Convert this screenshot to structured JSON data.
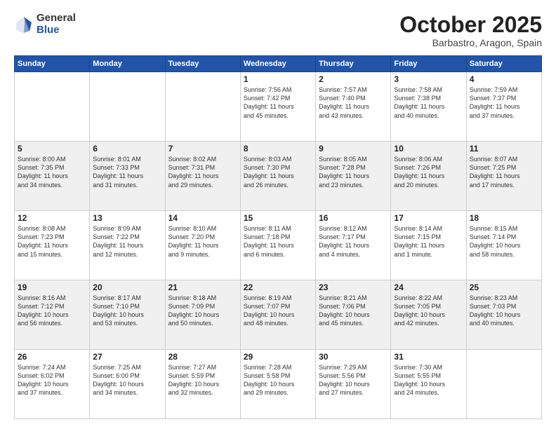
{
  "logo": {
    "general": "General",
    "blue": "Blue"
  },
  "header": {
    "month": "October 2025",
    "location": "Barbastro, Aragon, Spain"
  },
  "weekdays": [
    "Sunday",
    "Monday",
    "Tuesday",
    "Wednesday",
    "Thursday",
    "Friday",
    "Saturday"
  ],
  "weeks": [
    [
      {
        "day": "",
        "info": ""
      },
      {
        "day": "",
        "info": ""
      },
      {
        "day": "",
        "info": ""
      },
      {
        "day": "1",
        "info": "Sunrise: 7:56 AM\nSunset: 7:42 PM\nDaylight: 11 hours\nand 45 minutes."
      },
      {
        "day": "2",
        "info": "Sunrise: 7:57 AM\nSunset: 7:40 PM\nDaylight: 11 hours\nand 43 minutes."
      },
      {
        "day": "3",
        "info": "Sunrise: 7:58 AM\nSunset: 7:38 PM\nDaylight: 11 hours\nand 40 minutes."
      },
      {
        "day": "4",
        "info": "Sunrise: 7:59 AM\nSunset: 7:37 PM\nDaylight: 11 hours\nand 37 minutes."
      }
    ],
    [
      {
        "day": "5",
        "info": "Sunrise: 8:00 AM\nSunset: 7:35 PM\nDaylight: 11 hours\nand 34 minutes."
      },
      {
        "day": "6",
        "info": "Sunrise: 8:01 AM\nSunset: 7:33 PM\nDaylight: 11 hours\nand 31 minutes."
      },
      {
        "day": "7",
        "info": "Sunrise: 8:02 AM\nSunset: 7:31 PM\nDaylight: 11 hours\nand 29 minutes."
      },
      {
        "day": "8",
        "info": "Sunrise: 8:03 AM\nSunset: 7:30 PM\nDaylight: 11 hours\nand 26 minutes."
      },
      {
        "day": "9",
        "info": "Sunrise: 8:05 AM\nSunset: 7:28 PM\nDaylight: 11 hours\nand 23 minutes."
      },
      {
        "day": "10",
        "info": "Sunrise: 8:06 AM\nSunset: 7:26 PM\nDaylight: 11 hours\nand 20 minutes."
      },
      {
        "day": "11",
        "info": "Sunrise: 8:07 AM\nSunset: 7:25 PM\nDaylight: 11 hours\nand 17 minutes."
      }
    ],
    [
      {
        "day": "12",
        "info": "Sunrise: 8:08 AM\nSunset: 7:23 PM\nDaylight: 11 hours\nand 15 minutes."
      },
      {
        "day": "13",
        "info": "Sunrise: 8:09 AM\nSunset: 7:22 PM\nDaylight: 11 hours\nand 12 minutes."
      },
      {
        "day": "14",
        "info": "Sunrise: 8:10 AM\nSunset: 7:20 PM\nDaylight: 11 hours\nand 9 minutes."
      },
      {
        "day": "15",
        "info": "Sunrise: 8:11 AM\nSunset: 7:18 PM\nDaylight: 11 hours\nand 6 minutes."
      },
      {
        "day": "16",
        "info": "Sunrise: 8:12 AM\nSunset: 7:17 PM\nDaylight: 11 hours\nand 4 minutes."
      },
      {
        "day": "17",
        "info": "Sunrise: 8:14 AM\nSunset: 7:15 PM\nDaylight: 11 hours\nand 1 minute."
      },
      {
        "day": "18",
        "info": "Sunrise: 8:15 AM\nSunset: 7:14 PM\nDaylight: 10 hours\nand 58 minutes."
      }
    ],
    [
      {
        "day": "19",
        "info": "Sunrise: 8:16 AM\nSunset: 7:12 PM\nDaylight: 10 hours\nand 56 minutes."
      },
      {
        "day": "20",
        "info": "Sunrise: 8:17 AM\nSunset: 7:10 PM\nDaylight: 10 hours\nand 53 minutes."
      },
      {
        "day": "21",
        "info": "Sunrise: 8:18 AM\nSunset: 7:09 PM\nDaylight: 10 hours\nand 50 minutes."
      },
      {
        "day": "22",
        "info": "Sunrise: 8:19 AM\nSunset: 7:07 PM\nDaylight: 10 hours\nand 48 minutes."
      },
      {
        "day": "23",
        "info": "Sunrise: 8:21 AM\nSunset: 7:06 PM\nDaylight: 10 hours\nand 45 minutes."
      },
      {
        "day": "24",
        "info": "Sunrise: 8:22 AM\nSunset: 7:05 PM\nDaylight: 10 hours\nand 42 minutes."
      },
      {
        "day": "25",
        "info": "Sunrise: 8:23 AM\nSunset: 7:03 PM\nDaylight: 10 hours\nand 40 minutes."
      }
    ],
    [
      {
        "day": "26",
        "info": "Sunrise: 7:24 AM\nSunset: 6:02 PM\nDaylight: 10 hours\nand 37 minutes."
      },
      {
        "day": "27",
        "info": "Sunrise: 7:25 AM\nSunset: 6:00 PM\nDaylight: 10 hours\nand 34 minutes."
      },
      {
        "day": "28",
        "info": "Sunrise: 7:27 AM\nSunset: 5:59 PM\nDaylight: 10 hours\nand 32 minutes."
      },
      {
        "day": "29",
        "info": "Sunrise: 7:28 AM\nSunset: 5:58 PM\nDaylight: 10 hours\nand 29 minutes."
      },
      {
        "day": "30",
        "info": "Sunrise: 7:29 AM\nSunset: 5:56 PM\nDaylight: 10 hours\nand 27 minutes."
      },
      {
        "day": "31",
        "info": "Sunrise: 7:30 AM\nSunset: 5:55 PM\nDaylight: 10 hours\nand 24 minutes."
      },
      {
        "day": "",
        "info": ""
      }
    ]
  ]
}
